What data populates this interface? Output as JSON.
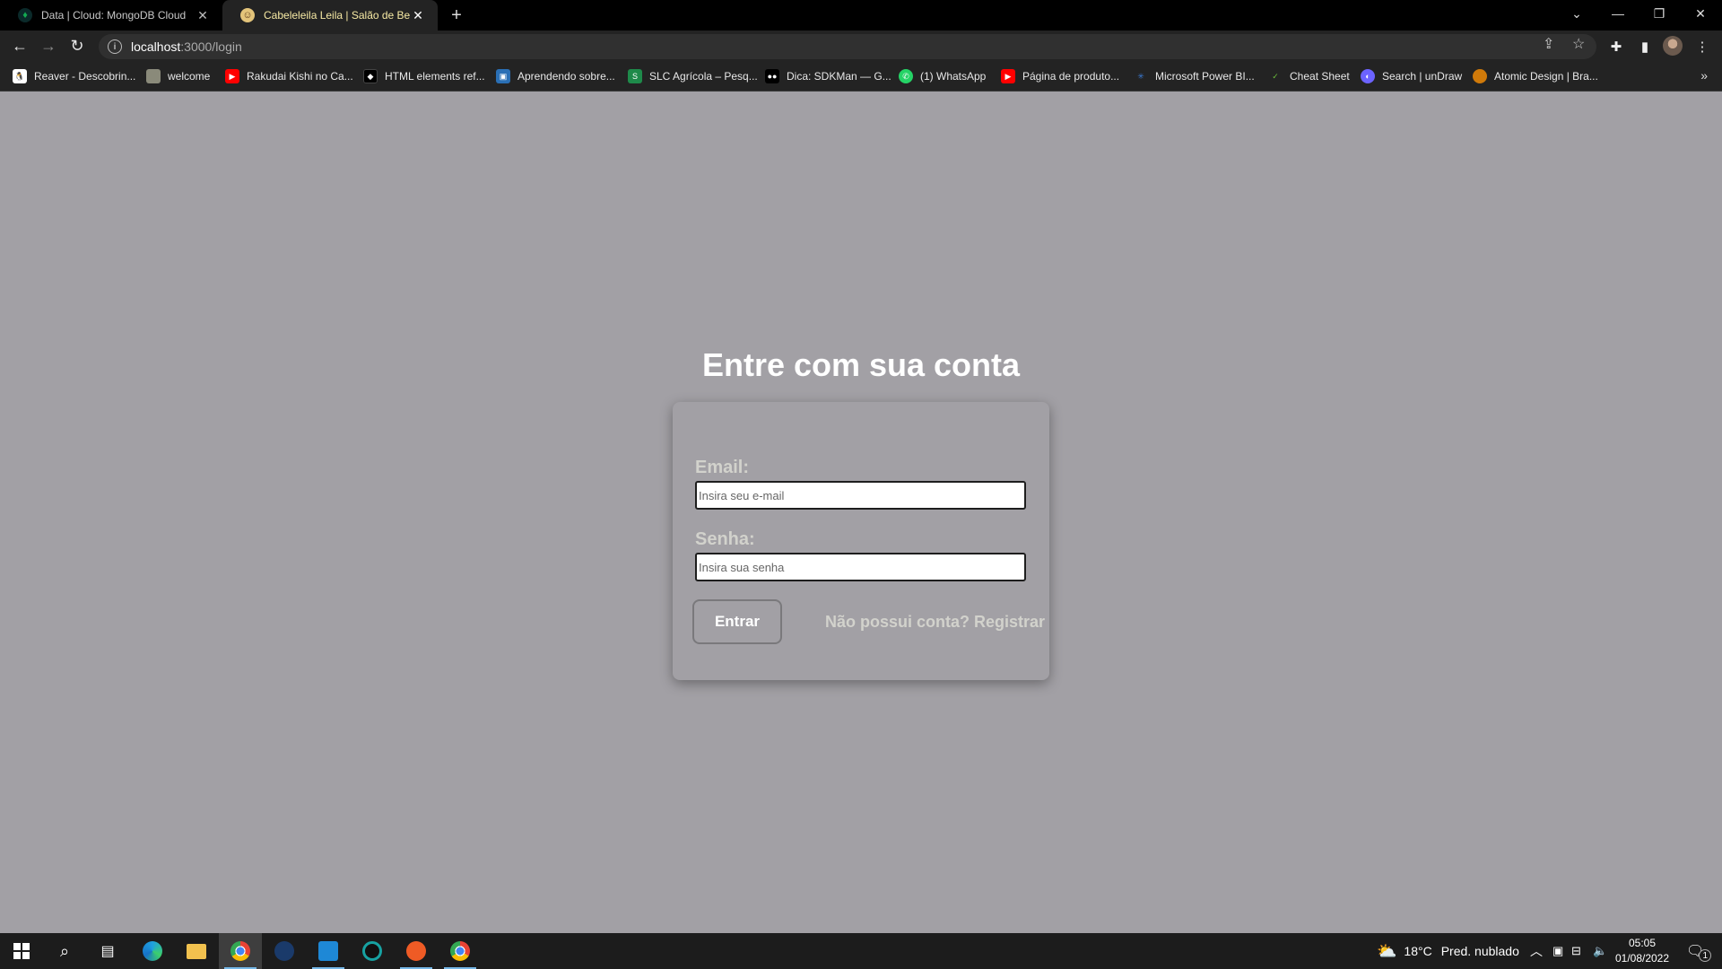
{
  "browser": {
    "tabs": [
      {
        "label": "Data | Cloud: MongoDB Cloud",
        "icon": "mongodb-leaf-icon",
        "active": false
      },
      {
        "label": "Cabeleleila Leila | Salão de Beleza",
        "icon": "salon-favicon-icon",
        "active": true
      }
    ],
    "new_tab_symbol": "+",
    "window_controls": {
      "tab_search": "⌄",
      "minimize": "—",
      "restore": "❐",
      "close": "✕"
    },
    "nav": {
      "back": "←",
      "forward": "→",
      "reload": "↻"
    },
    "url": {
      "host": "localhost",
      "path": ":3000/login"
    },
    "bookmarks": [
      {
        "label": "Reaver - Descobrin...",
        "icon": "penguin-icon",
        "color": "#ffffff"
      },
      {
        "label": "welcome",
        "icon": "photo-favicon-icon",
        "color": "#8a8a7a"
      },
      {
        "label": "Rakudai Kishi no Ca...",
        "icon": "youtube-icon",
        "color": "#ff0000"
      },
      {
        "label": "HTML elements ref...",
        "icon": "mdn-icon",
        "color": "#000000"
      },
      {
        "label": "Aprendendo sobre...",
        "icon": "cube-icon",
        "color": "#2a6fb5"
      },
      {
        "label": "SLC Agrícola – Pesq...",
        "icon": "slc-icon",
        "color": "#1e8a4a"
      },
      {
        "label": "Dica: SDKMan — G...",
        "icon": "medium-icon",
        "color": "#000000"
      },
      {
        "label": "(1) WhatsApp",
        "icon": "whatsapp-icon",
        "color": "#25d366"
      },
      {
        "label": "Página de produto...",
        "icon": "youtube-icon",
        "color": "#ff0000"
      },
      {
        "label": "Microsoft Power BI...",
        "icon": "powerbi-icon",
        "color": "#3a7bd5"
      },
      {
        "label": "Cheat Sheet",
        "icon": "leaf-icon",
        "color": "#6bbf3b"
      },
      {
        "label": "Search | unDraw",
        "icon": "undraw-icon",
        "color": "#6c63ff"
      },
      {
        "label": "Atomic Design | Bra...",
        "icon": "orange-circle-icon",
        "color": "#d07a0a"
      }
    ],
    "bookmarks_more": "»"
  },
  "page": {
    "title": "Entre com sua conta",
    "form": {
      "email_label": "Email:",
      "email_placeholder": "Insira seu e-mail",
      "email_value": "",
      "password_label": "Senha:",
      "password_placeholder": "Insira sua senha",
      "password_value": "",
      "submit_label": "Entrar",
      "register_link": "Não possui conta? Registrar"
    }
  },
  "taskbar": {
    "apps": [
      {
        "name": "start",
        "icon": "windows-icon"
      },
      {
        "name": "search",
        "icon": "search-icon"
      },
      {
        "name": "task-view",
        "icon": "task-view-icon"
      },
      {
        "name": "edge",
        "icon": "edge-icon",
        "color": "#1fa0e0"
      },
      {
        "name": "file-explorer",
        "icon": "folder-icon",
        "color": "#f2c14e"
      },
      {
        "name": "chrome",
        "icon": "chrome-icon",
        "color": "#e04a3a",
        "active": true,
        "running": true
      },
      {
        "name": "steam",
        "icon": "steam-icon",
        "color": "#1a3a6a"
      },
      {
        "name": "vscode",
        "icon": "vscode-icon",
        "color": "#1e88d6",
        "running": true
      },
      {
        "name": "gitkraken",
        "icon": "gitkraken-icon",
        "color": "#17a2a2"
      },
      {
        "name": "postman",
        "icon": "postman-icon",
        "color": "#ef5b25",
        "running": true
      },
      {
        "name": "chrome-2",
        "icon": "chrome-icon",
        "color": "#e04a3a",
        "running": true
      }
    ],
    "weather": {
      "temp": "18°C",
      "desc": "Pred. nublado"
    },
    "clock": {
      "time": "05:05",
      "date": "01/08/2022"
    },
    "notifications_count": "1"
  },
  "colors": {
    "page_bg": "#a2a0a5",
    "label": "#d2d2cc",
    "title": "#ffffff"
  }
}
